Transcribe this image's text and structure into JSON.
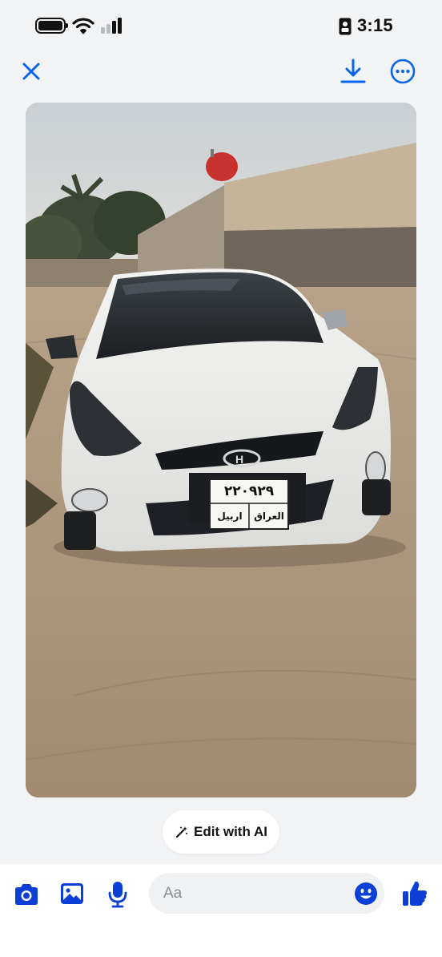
{
  "status_bar": {
    "time": "3:15",
    "icons": [
      "battery-icon",
      "wifi-icon",
      "cellular-signal-icon",
      "id-badge-icon"
    ]
  },
  "toolbar": {
    "icons": [
      "close-icon",
      "download-icon",
      "more-icon"
    ]
  },
  "photo": {
    "subject": "white Hyundai sedan",
    "plate_number": "٢٢٠٩٢٩",
    "plate_country": "العراق",
    "plate_region": "اربيل"
  },
  "edit_ai": {
    "label": "Edit with AI",
    "icon": "magic-wand-icon"
  },
  "composer": {
    "placeholder": "Aa",
    "icons": [
      "camera-icon",
      "gallery-icon",
      "microphone-icon",
      "emoji-icon",
      "thumbs-up-icon"
    ]
  },
  "colors": {
    "accent": "#0a66e8",
    "composer_icon": "#0b3fd6",
    "background": "#f2f3f5"
  }
}
